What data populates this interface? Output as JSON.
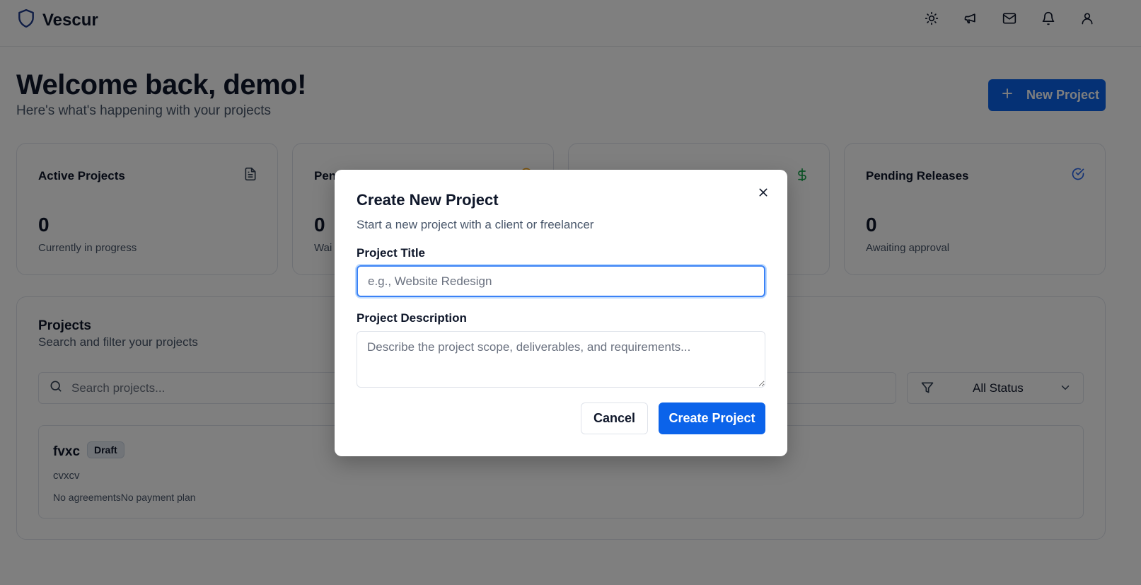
{
  "app": {
    "name": "Vescur"
  },
  "header": {
    "icons": [
      "sun-icon",
      "megaphone-icon",
      "mail-icon",
      "bell-icon",
      "user-icon"
    ]
  },
  "welcome": {
    "title": "Welcome back, demo!",
    "subtitle": "Here's what's happening with your projects",
    "new_project_label": "New Project"
  },
  "stats": [
    {
      "title": "Active Projects",
      "value": "0",
      "subtitle": "Currently in progress",
      "icon": "document-icon"
    },
    {
      "title": "Pen",
      "value": "0",
      "subtitle": "Wai",
      "icon": "alert-icon"
    },
    {
      "title": "",
      "value": "",
      "subtitle": "",
      "icon": "dollar-icon"
    },
    {
      "title": "Pending Releases",
      "value": "0",
      "subtitle": "Awaiting approval",
      "icon": "check-circle-icon"
    }
  ],
  "projects": {
    "title": "Projects",
    "subtitle": "Search and filter your projects",
    "search_placeholder": "Search projects...",
    "status_filter": "All Status",
    "items": [
      {
        "name": "fvxc",
        "badge": "Draft",
        "description": "cvxcv",
        "meta": "No agreementsNo payment plan"
      }
    ]
  },
  "modal": {
    "title": "Create New Project",
    "subtitle": "Start a new project with a client or freelancer",
    "title_label": "Project Title",
    "title_placeholder": "e.g., Website Redesign",
    "title_value": "",
    "description_label": "Project Description",
    "description_placeholder": "Describe the project scope, deliverables, and requirements...",
    "description_value": "",
    "cancel_label": "Cancel",
    "create_label": "Create Project"
  },
  "colors": {
    "primary": "#0b63ea",
    "brand_icon": "#1e3a8a",
    "overlay": "rgba(0,0,0,0.5)",
    "dollar_icon": "#16a34a",
    "check_icon": "#2563eb",
    "alert_icon": "#f59e0b"
  }
}
